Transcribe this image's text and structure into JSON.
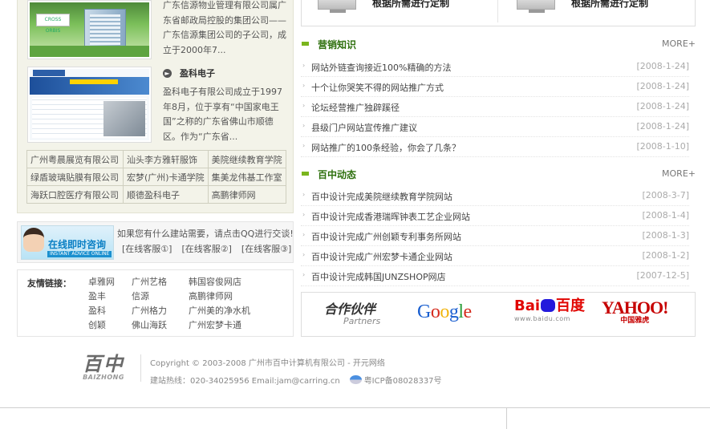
{
  "cases": {
    "case1_text": "广东信源物业管理有限公司属广东省邮政局控股的集团公司——广东信源集团公司的子公司，成立于2000年7...",
    "case2_title": "盈科电子",
    "case2_text": "盈科电子有限公司成立于1997年8月，位于享有“中国家电王国”之称的广东省佛山市顺德区。作为“广东省...",
    "thumb1_logo": "CROSS ORBIS",
    "links_rows": [
      [
        "广州粤晨展览有限公司",
        "汕头李方雅轩服饰",
        "美院继续教育学院"
      ],
      [
        "绿盾玻璃贴膜有限公司",
        "宏梦(广州)卡通学院",
        "集美龙伟基工作室"
      ],
      [
        "海跃口腔医疗有限公司",
        "顺德盈科电子",
        "高鹏律师网"
      ]
    ]
  },
  "qq": {
    "banner_title": "在线即时咨询",
    "banner_sub": "INSTANT ADVICE ONLINE",
    "prompt": "如果您有什么建站需要，请点击QQ进行交谈!",
    "services": [
      "[在线客服①]",
      "[在线客服②]",
      "[在线客服③]"
    ]
  },
  "friend_links": {
    "label": "友情链接：",
    "items": [
      "卓雅网",
      "广州艺格",
      "韩国容俊网店",
      "盈丰",
      "信源",
      "高鹏律师网",
      "盈科",
      "广州格力",
      "广州美的净水机",
      "创颖",
      "佛山海跃",
      "广州宏梦卡通"
    ]
  },
  "products": {
    "item1": "根据所需进行定制",
    "item2": "根据所需进行定制"
  },
  "marketing": {
    "title": "营销知识",
    "more": "MORE+",
    "items": [
      {
        "title": "网站外链查询接近100%精确的方法",
        "date": "[2008-1-24]"
      },
      {
        "title": "十个让你哭笑不得的网站推广方式",
        "date": "[2008-1-24]"
      },
      {
        "title": "论坛经营推广独辟蹊径",
        "date": "[2008-1-24]"
      },
      {
        "title": "县级门户网站宣传推广建议",
        "date": "[2008-1-24]"
      },
      {
        "title": "网站推广的100条经验，你会了几条？",
        "date": "[2008-1-10]"
      }
    ]
  },
  "news": {
    "title": "百中动态",
    "more": "MORE+",
    "items": [
      {
        "title": "百中设计完成美院继续教育学院网站",
        "date": "[2008-3-7]"
      },
      {
        "title": "百中设计完成香港瑞晖钟表工艺企业网站",
        "date": "[2008-1-4]"
      },
      {
        "title": "百中设计完成广州创颖专利事务所网站",
        "date": "[2008-1-3]"
      },
      {
        "title": "百中设计完成广州宏梦卡通企业网站",
        "date": "[2008-1-2]"
      },
      {
        "title": "百中设计完成韩国JUNZSHOP网店",
        "date": "[2007-12-5]"
      }
    ]
  },
  "partners": {
    "title_zh": "合作伙伴",
    "title_en": "Partners",
    "google": [
      "G",
      "o",
      "o",
      "g",
      "l",
      "e"
    ],
    "google_colors": [
      "#1a5fd0",
      "#d52b1e",
      "#f2b50f",
      "#1a5fd0",
      "#2a9d3a",
      "#d52b1e"
    ],
    "baidu_a": "Bai",
    "baidu_b": "百度",
    "baidu_url": "www.baidu.com",
    "yahoo": "YAHOO!",
    "yahoo_cn": "中国雅虎"
  },
  "footer": {
    "logo_zh": "百中",
    "logo_en": "BAIZHONG",
    "copyright": "Copyright © 2003-2008 广州市百中计算机有限公司 - 开元网络",
    "contact": "建站热线：020-34025956 Email:jam@carring.cn",
    "icp": "粤ICP备08028337号"
  }
}
